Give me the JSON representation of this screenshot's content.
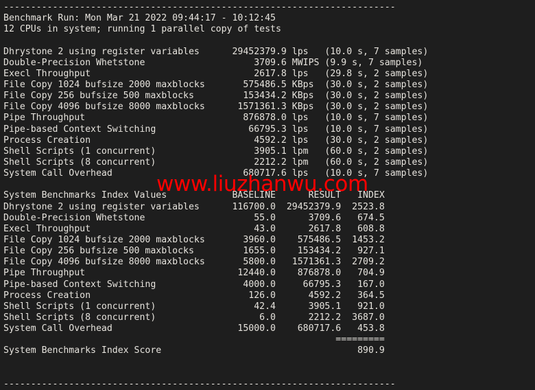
{
  "terminal": {
    "background_color": "#1e1e1e",
    "text_color": "#e6e3dd",
    "watermark_color": "#ff0000",
    "separator_top": "------------------------------------------------------------------------",
    "separator_bottom": "------------------------------------------------------------------------",
    "index_separator": "=========",
    "watermark_text": "www.liuzhanwu.com"
  },
  "header": {
    "benchmark_run": "Benchmark Run: Mon Mar 21 2022 09:44:17 - 10:12:45",
    "cpu_info": "12 CPUs in system; running 1 parallel copy of tests"
  },
  "results": {
    "rows": [
      {
        "name": "Dhrystone 2 using register variables",
        "value": "29452379.9",
        "unit": "lps",
        "timing": "(10.0 s, 7 samples)"
      },
      {
        "name": "Double-Precision Whetstone",
        "value": "3709.6",
        "unit": "MWIPS",
        "timing": "(9.9 s, 7 samples)"
      },
      {
        "name": "Execl Throughput",
        "value": "2617.8",
        "unit": "lps",
        "timing": "(29.8 s, 2 samples)"
      },
      {
        "name": "File Copy 1024 bufsize 2000 maxblocks",
        "value": "575486.5",
        "unit": "KBps",
        "timing": "(30.0 s, 2 samples)"
      },
      {
        "name": "File Copy 256 bufsize 500 maxblocks",
        "value": "153434.2",
        "unit": "KBps",
        "timing": "(30.0 s, 2 samples)"
      },
      {
        "name": "File Copy 4096 bufsize 8000 maxblocks",
        "value": "1571361.3",
        "unit": "KBps",
        "timing": "(30.0 s, 2 samples)"
      },
      {
        "name": "Pipe Throughput",
        "value": "876878.0",
        "unit": "lps",
        "timing": "(10.0 s, 7 samples)"
      },
      {
        "name": "Pipe-based Context Switching",
        "value": "66795.3",
        "unit": "lps",
        "timing": "(10.0 s, 7 samples)"
      },
      {
        "name": "Process Creation",
        "value": "4592.2",
        "unit": "lps",
        "timing": "(30.0 s, 2 samples)"
      },
      {
        "name": "Shell Scripts (1 concurrent)",
        "value": "3905.1",
        "unit": "lpm",
        "timing": "(60.0 s, 2 samples)"
      },
      {
        "name": "Shell Scripts (8 concurrent)",
        "value": "2212.2",
        "unit": "lpm",
        "timing": "(60.0 s, 2 samples)"
      },
      {
        "name": "System Call Overhead",
        "value": "680717.6",
        "unit": "lps",
        "timing": "(10.0 s, 7 samples)"
      }
    ]
  },
  "index_table": {
    "title": "System Benchmarks Index Values",
    "col_baseline": "BASELINE",
    "col_result": "RESULT",
    "col_index": "INDEX",
    "rows": [
      {
        "name": "Dhrystone 2 using register variables",
        "baseline": "116700.0",
        "result": "29452379.9",
        "index": "2523.8"
      },
      {
        "name": "Double-Precision Whetstone",
        "baseline": "55.0",
        "result": "3709.6",
        "index": "674.5"
      },
      {
        "name": "Execl Throughput",
        "baseline": "43.0",
        "result": "2617.8",
        "index": "608.8"
      },
      {
        "name": "File Copy 1024 bufsize 2000 maxblocks",
        "baseline": "3960.0",
        "result": "575486.5",
        "index": "1453.2"
      },
      {
        "name": "File Copy 256 bufsize 500 maxblocks",
        "baseline": "1655.0",
        "result": "153434.2",
        "index": "927.1"
      },
      {
        "name": "File Copy 4096 bufsize 8000 maxblocks",
        "baseline": "5800.0",
        "result": "1571361.3",
        "index": "2709.2"
      },
      {
        "name": "Pipe Throughput",
        "baseline": "12440.0",
        "result": "876878.0",
        "index": "704.9"
      },
      {
        "name": "Pipe-based Context Switching",
        "baseline": "4000.0",
        "result": "66795.3",
        "index": "167.0"
      },
      {
        "name": "Process Creation",
        "baseline": "126.0",
        "result": "4592.2",
        "index": "364.5"
      },
      {
        "name": "Shell Scripts (1 concurrent)",
        "baseline": "42.4",
        "result": "3905.1",
        "index": "921.0"
      },
      {
        "name": "Shell Scripts (8 concurrent)",
        "baseline": "6.0",
        "result": "2212.2",
        "index": "3687.0"
      },
      {
        "name": "System Call Overhead",
        "baseline": "15000.0",
        "result": "680717.6",
        "index": "453.8"
      }
    ],
    "score_label": "System Benchmarks Index Score",
    "score_value": "890.9"
  }
}
